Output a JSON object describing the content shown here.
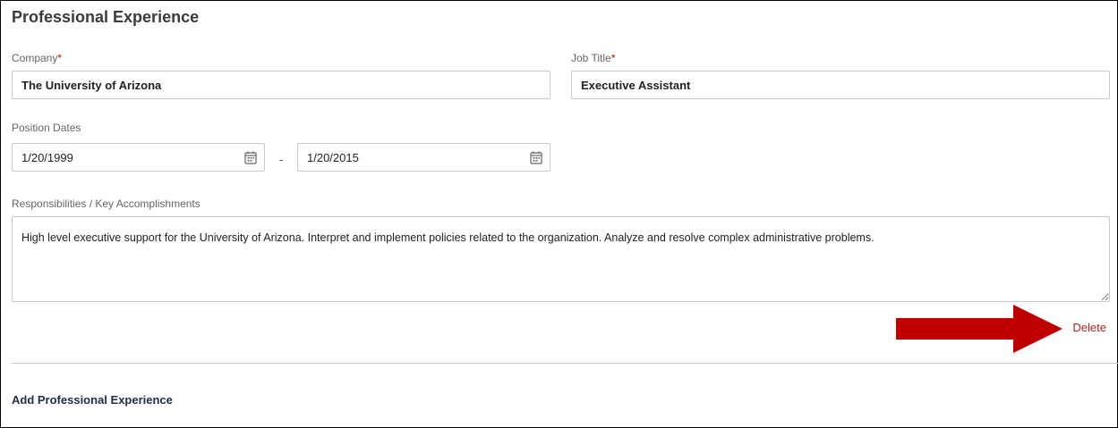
{
  "section": {
    "title": "Professional Experience"
  },
  "company": {
    "label": "Company",
    "required_mark": "*",
    "value": "The University of Arizona"
  },
  "job_title": {
    "label": "Job Title",
    "required_mark": "*",
    "value": "Executive Assistant"
  },
  "position_dates": {
    "label": "Position Dates",
    "start": "1/20/1999",
    "separator": "-",
    "end": "1/20/2015",
    "icon": "calendar-icon"
  },
  "responsibilities": {
    "label": "Responsibilities / Key Accomplishments",
    "value": "High level executive support for the University of Arizona. Interpret and implement policies related to the organization. Analyze and resolve complex administrative problems."
  },
  "actions": {
    "delete_label": "Delete",
    "add_label": "Add Professional Experience"
  },
  "annotation": {
    "arrow_color": "#c00000",
    "icon": "arrow-right-icon"
  },
  "colors": {
    "required": "#c00000",
    "delete": "#b22222",
    "link": "#1f2d45"
  }
}
